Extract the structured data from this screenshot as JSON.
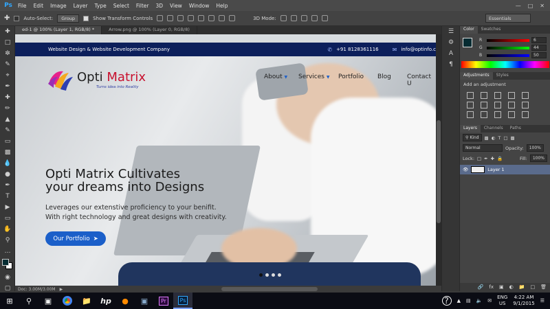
{
  "menubar": {
    "logo": "Ps",
    "items": [
      "File",
      "Edit",
      "Image",
      "Layer",
      "Type",
      "Select",
      "Filter",
      "3D",
      "View",
      "Window",
      "Help"
    ]
  },
  "options": {
    "auto_select_label": "Auto-Select:",
    "group_value": "Group",
    "transform_label": "Show Transform Controls",
    "mode_label": "3D Mode:",
    "workspace": "Essentials"
  },
  "doc_tabs": [
    {
      "label": "ed-1 @ 100% (Layer 1, RGB/8) *"
    },
    {
      "label": "Arrow.png @ 100% (Layer 0, RGB/8)"
    }
  ],
  "site": {
    "company": "Website Design & Website Development Company",
    "phone": "+91 8128361116",
    "email": "info@optinfo.c",
    "logo_word_a": "Opti",
    "logo_word_b": "Matrix",
    "tagline": "Turns idea into Reality",
    "nav": [
      "About",
      "Services",
      "Portfolio",
      "Blog",
      "Contact U"
    ],
    "hero_title_1": "Opti Matrix Cultivates",
    "hero_title_2": "your dreams into Designs",
    "hero_text_1": "Leverages our extenstive proficiency to your benifit.",
    "hero_text_2": "With right technology and great designs with creativity.",
    "hero_button": "Our Portfolio"
  },
  "status": {
    "doc": "Doc: 3.00M/3.00M"
  },
  "panels": {
    "color_tabs": [
      "Color",
      "Swatches"
    ],
    "rgb": [
      {
        "label": "R",
        "value": "6",
        "color": "#d33"
      },
      {
        "label": "G",
        "value": "44",
        "color": "#3c3"
      },
      {
        "label": "B",
        "value": "50",
        "color": "#33d"
      }
    ],
    "adj_tabs": [
      "Adjustments",
      "Styles"
    ],
    "adj_title": "Add an adjustment",
    "layers_tabs": [
      "Layers",
      "Channels",
      "Paths"
    ],
    "kind": "Kind",
    "blend": "Normal",
    "opacity_label": "Opacity:",
    "opacity": "100%",
    "lock_label": "Lock:",
    "fill_label": "Fill:",
    "fill": "100%",
    "layer_name": "Layer 1"
  },
  "taskbar": {
    "lang": "ENG",
    "region": "US",
    "time": "4:22 AM",
    "date": "9/1/2015"
  },
  "colors": {
    "accent": "#1b5fc9",
    "site_bar": "#0c1f5b",
    "logo_red": "#c8102e"
  }
}
